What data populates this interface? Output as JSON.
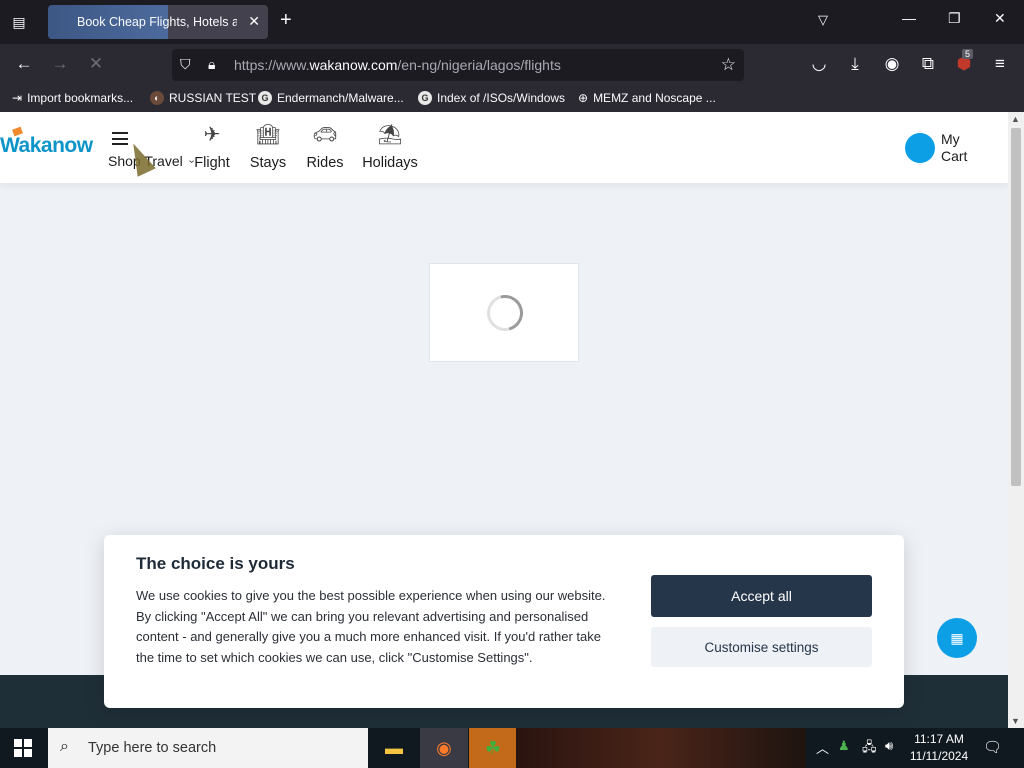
{
  "browser": {
    "tab_title": "Book Cheap Flights, Hotels and",
    "url_prefix": "https://www.",
    "url_host": "wakanow.com",
    "url_path": "/en-ng/nigeria/lagos/flights",
    "extension_badge": "5",
    "bookmarks": [
      {
        "label": "Import bookmarks...",
        "icon": "import-icon"
      },
      {
        "label": "RUSSIAN TEST",
        "icon": "russian-test-icon"
      },
      {
        "label": "Endermanch/Malware...",
        "icon": "google-icon"
      },
      {
        "label": "Index of /ISOs/Windows",
        "icon": "google-icon"
      },
      {
        "label": "MEMZ and Noscape ...",
        "icon": "globe-icon"
      }
    ]
  },
  "site": {
    "logo": "Wakanow",
    "shop_travel": "Shop Travel",
    "nav": [
      {
        "label": "Flight",
        "icon": "airplane-icon"
      },
      {
        "label": "Stays",
        "icon": "hotel-icon"
      },
      {
        "label": "Rides",
        "icon": "car-icon"
      },
      {
        "label": "Holidays",
        "icon": "beach-umbrella-icon"
      }
    ],
    "cart_label": "My Cart"
  },
  "cookie": {
    "title": "The choice is yours",
    "body": "We use cookies to give you the best possible experience when using our website. By clicking \"Accept All\" we can bring you relevant advertising and personalised content - and generally give you a much more enhanced visit. If you'd rather take the time to set which cookies we can use, click \"Customise Settings\".",
    "accept_label": "Accept all",
    "customise_label": "Customise settings"
  },
  "taskbar": {
    "search_placeholder": "Type here to search",
    "time": "11:17 AM",
    "date": "11/11/2024"
  },
  "colors": {
    "accent": "#0d9fe6",
    "accept_button": "#26364a",
    "page_bg": "#eef1f6"
  }
}
